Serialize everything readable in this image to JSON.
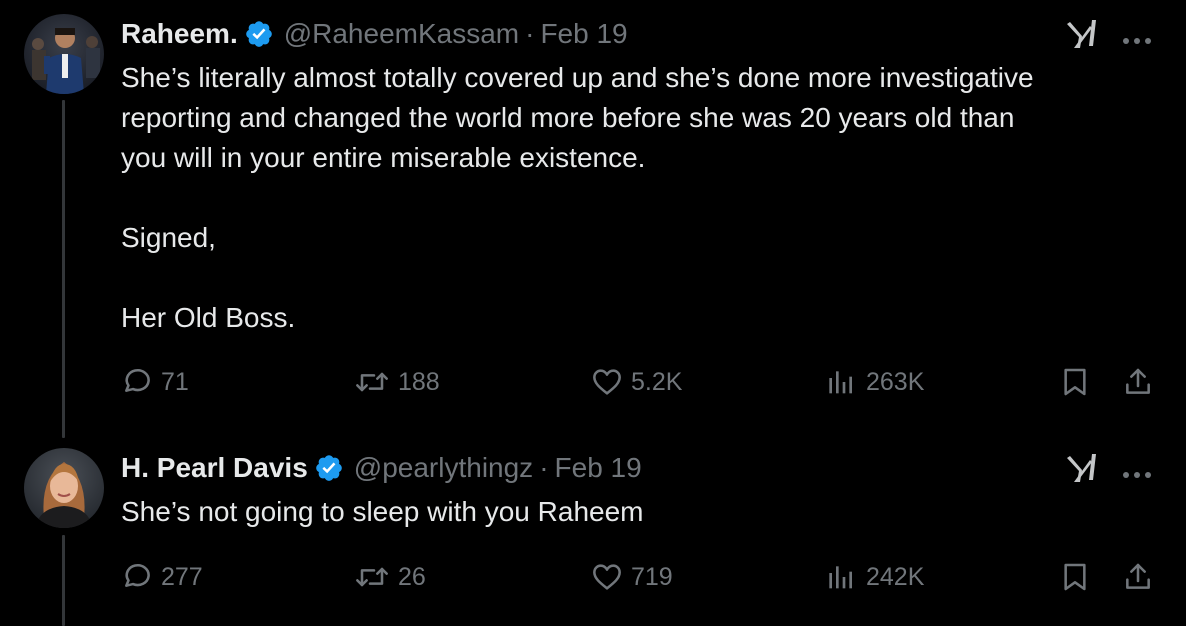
{
  "tweets": [
    {
      "display_name": "Raheem.",
      "handle": "@RaheemKassam",
      "separator": "·",
      "date": "Feb 19",
      "text": "She’s literally almost totally covered up and she’s done more investigative\nreporting and changed the world more before she was 20 years old than\nyou will in your entire miserable existence.\n\nSigned,\n\nHer Old Boss.",
      "verified": true,
      "stats": {
        "replies": "71",
        "reposts": "188",
        "likes": "5.2K",
        "views": "263K"
      }
    },
    {
      "display_name": "H. Pearl Davis",
      "handle": "@pearlythingz",
      "separator": "·",
      "date": "Feb 19",
      "text": "She’s not going to sleep with you Raheem",
      "verified": true,
      "stats": {
        "replies": "277",
        "reposts": "26",
        "likes": "719",
        "views": "242K"
      }
    }
  ],
  "colors": {
    "background": "#000000",
    "text_primary": "#e7e9ea",
    "text_secondary": "#71767b",
    "verified_badge": "#1d9bf0",
    "thread_line": "#333639"
  },
  "icons": [
    "avatar",
    "verified-badge-icon",
    "grok-icon",
    "more-icon",
    "reply-icon",
    "repost-icon",
    "like-icon",
    "views-icon",
    "bookmark-icon",
    "share-icon"
  ]
}
